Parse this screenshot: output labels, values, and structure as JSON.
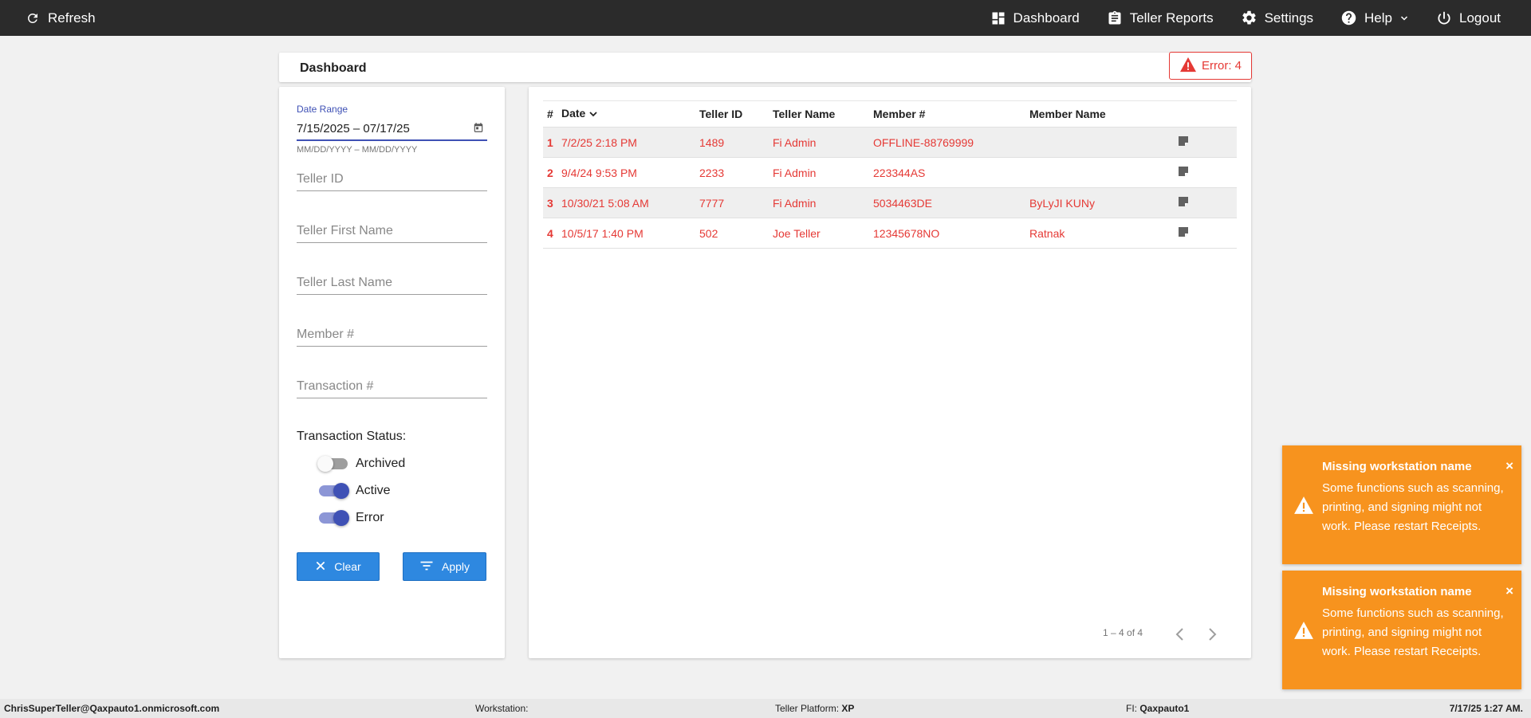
{
  "topbar": {
    "refresh_label": "Refresh",
    "nav": {
      "dashboard": "Dashboard",
      "teller_reports": "Teller Reports",
      "settings": "Settings",
      "help": "Help",
      "logout": "Logout"
    }
  },
  "header": {
    "title": "Dashboard",
    "error_badge": "Error: 4"
  },
  "filters": {
    "date_range_label": "Date Range",
    "date_range_value": "7/15/2025 – 07/17/25",
    "date_hint": "MM/DD/YYYY – MM/DD/YYYY",
    "teller_id_placeholder": "Teller ID",
    "teller_first_name_placeholder": "Teller First Name",
    "teller_last_name_placeholder": "Teller Last Name",
    "member_placeholder": "Member #",
    "transaction_placeholder": "Transaction #",
    "status_label": "Transaction Status:",
    "toggles": {
      "archived": {
        "label": "Archived",
        "on": false
      },
      "active": {
        "label": "Active",
        "on": true
      },
      "error": {
        "label": "Error",
        "on": true
      }
    },
    "clear_label": "Clear",
    "apply_label": "Apply"
  },
  "table": {
    "columns": [
      "#",
      "Date",
      "Teller ID",
      "Teller Name",
      "Member #",
      "Member Name"
    ],
    "rows": [
      {
        "num": "1",
        "date": "7/2/25 2:18 PM",
        "teller_id": "1489",
        "teller_name": "Fi Admin",
        "member": "OFFLINE-88769999",
        "member_name": ""
      },
      {
        "num": "2",
        "date": "9/4/24 9:53 PM",
        "teller_id": "2233",
        "teller_name": "Fi Admin",
        "member": "223344AS",
        "member_name": ""
      },
      {
        "num": "3",
        "date": "10/30/21 5:08 AM",
        "teller_id": "7777",
        "teller_name": "Fi Admin",
        "member": "5034463DE",
        "member_name": "ByLyJI KUNy"
      },
      {
        "num": "4",
        "date": "10/5/17 1:40 PM",
        "teller_id": "502",
        "teller_name": "Joe Teller",
        "member": "12345678NO",
        "member_name": "Ratnak"
      }
    ],
    "pagination": "1 – 4 of 4"
  },
  "toasts": [
    {
      "title": "Missing workstation name",
      "message": "Some functions such as scanning, printing, and signing might not work. Please restart Receipts.",
      "close": "×"
    },
    {
      "title": "Missing workstation name",
      "message": "Some functions such as scanning, printing, and signing might not work. Please restart Receipts.",
      "close": "×"
    }
  ],
  "footer": {
    "user": "ChrisSuperTeller@Qaxpauto1.onmicrosoft.com",
    "workstation_label": "Workstation:",
    "platform_label": "Teller Platform: ",
    "platform_value": "XP",
    "fi_label": "FI: ",
    "fi_value": "Qaxpauto1",
    "datetime": "7/17/25 1:27 AM."
  },
  "colors": {
    "topbar": "#2b2b2b",
    "accent": "#3f51b5",
    "error": "#e53935",
    "button": "#2e88e0",
    "toast": "#f7931e"
  }
}
